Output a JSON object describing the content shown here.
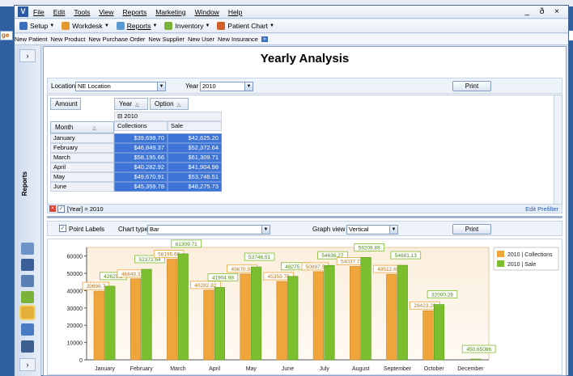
{
  "background": {
    "left_fragment": "ge",
    "right_fragment": "o"
  },
  "menubar": {
    "items": [
      "File",
      "Edit",
      "Tools",
      "View",
      "Reports",
      "Marketing",
      "Window",
      "Help"
    ],
    "controls": "_ ð ×"
  },
  "toolbar": {
    "items": [
      {
        "label": "Setup",
        "icon": "setup-icon",
        "color": "#3a6fc0"
      },
      {
        "label": "Workdesk",
        "icon": "workdesk-icon",
        "color": "#e39a2c"
      },
      {
        "label": "Reports",
        "icon": "reports-icon",
        "color": "#5a9bd6"
      },
      {
        "label": "Inventory",
        "icon": "inventory-icon",
        "color": "#7bb33a"
      },
      {
        "label": "Patient Chart",
        "icon": "patient-chart-icon",
        "color": "#d25f2a"
      }
    ]
  },
  "quickbar": {
    "links": [
      "New Patient",
      "New Product",
      "New Purchase Order",
      "New Supplier",
      "New User",
      "New Insurance"
    ]
  },
  "side_panel": {
    "label": "Reports"
  },
  "page": {
    "title": "Yearly Analysis"
  },
  "filters": {
    "location_label": "Location",
    "location_value": "NE Location",
    "year_label": "Year",
    "year_value": "2010",
    "print_label": "Print"
  },
  "pivot": {
    "data_field": "Amount",
    "col_fields": [
      "Year",
      "Option"
    ],
    "row_field": "Month",
    "year": "2010",
    "columns": [
      "Collections",
      "Sale"
    ],
    "rows": [
      {
        "month": "January",
        "collections": "$39,698.70",
        "sale": "$42,625.20"
      },
      {
        "month": "February",
        "collections": "$46,849.37",
        "sale": "$52,372.64"
      },
      {
        "month": "March",
        "collections": "$58,195.66",
        "sale": "$61,309.71"
      },
      {
        "month": "April",
        "collections": "$40,282.92",
        "sale": "$41,904.98"
      },
      {
        "month": "May",
        "collections": "$49,670.91",
        "sale": "$53,746.51"
      },
      {
        "month": "June",
        "collections": "$45,359.78",
        "sale": "$48,275.73"
      }
    ],
    "filter_text": "[Year] = 2010",
    "edit_prefilter": "Edit Prefilter"
  },
  "chart_options": {
    "point_labels": "Point Labels",
    "chart_type_label": "Chart type",
    "chart_type_value": "Bar",
    "graph_view_label": "Graph view",
    "graph_view_value": "Vertical",
    "print_label": "Print"
  },
  "chart_data": {
    "type": "bar",
    "categories": [
      "January",
      "February",
      "March",
      "April",
      "May",
      "June",
      "July",
      "August",
      "September",
      "October",
      "December"
    ],
    "series": [
      {
        "name": "2010 | Collections",
        "color": "#f0a53a",
        "values": [
          39698.7,
          46849.37,
          58195.66,
          40282.92,
          49670.91,
          45359.78,
          50997.5,
          54037.73,
          49512.69,
          28423.26,
          0
        ],
        "labels": [
          "39698.7",
          "46849.37",
          "58195.66",
          "40282.92",
          "49670.91",
          "45359.78",
          "50997.5",
          "54037.73",
          "49512.69",
          "28423.26",
          ""
        ]
      },
      {
        "name": "2010 | Sale",
        "color": "#7cbf2e",
        "values": [
          42625.2,
          52372.64,
          61309.71,
          41904.98,
          53746.51,
          48275.73,
          54636.27,
          59209.89,
          54681.13,
          32000.26,
          450.65
        ],
        "labels": [
          "42625.2",
          "52372.64",
          "61309.71",
          "41904.98",
          "53746.51",
          "48275.73",
          "54636.27",
          "59209.89",
          "54681.13",
          "32000.26",
          "450.65086"
        ]
      }
    ],
    "y_ticks": [
      "0",
      "10000",
      "20000",
      "30000",
      "40000",
      "50000",
      "60000"
    ],
    "ylim": [
      0,
      65000
    ],
    "legend_position": "top-right",
    "grid": false
  }
}
